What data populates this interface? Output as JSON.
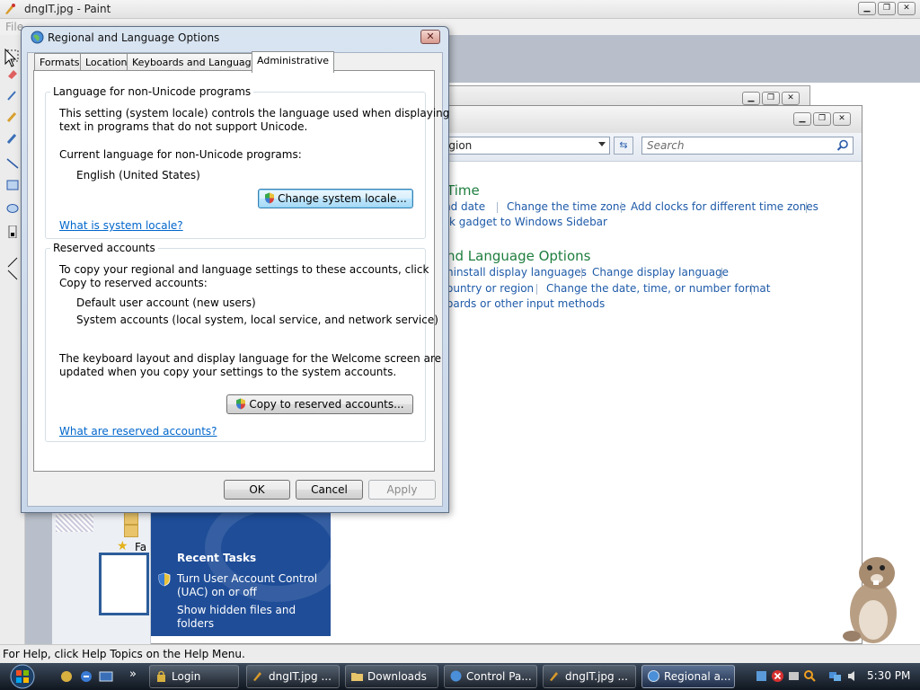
{
  "paint": {
    "title": "dngIT.jpg - Paint",
    "menu_file": "File",
    "status": "For Help, click Help Topics on the Help Menu."
  },
  "control_panel": {
    "address": "egion",
    "search_placeholder": "Search",
    "sections": [
      {
        "heading": "Time",
        "links": [
          "nd date",
          "Change the time zone",
          "Add clocks for different time zones",
          "k gadget to Windows Sidebar"
        ]
      },
      {
        "heading": "nd Language Options",
        "links": [
          "ninstall display languages",
          "Change display language",
          "ountry or region",
          "Change the date, time, or number format",
          "oards or other input methods"
        ]
      }
    ],
    "recent_tasks": {
      "title": "Recent Tasks",
      "items": [
        "Turn User Account Control (UAC) on or off",
        "Show hidden files and folders"
      ]
    },
    "explorer_fav_label": "Fa"
  },
  "dialog": {
    "title": "Regional and Language Options",
    "tabs": [
      "Formats",
      "Location",
      "Keyboards and Languages",
      "Administrative"
    ],
    "active_tab": "Administrative",
    "non_unicode": {
      "group_title": "Language for non-Unicode programs",
      "description_line1": "This setting (system locale) controls the language used when displaying",
      "description_line2": "text in programs that do not support Unicode.",
      "current_label": "Current language for non-Unicode programs:",
      "current_value": "English (United States)",
      "change_button": "Change system locale...",
      "help_link": "What is system locale?"
    },
    "reserved": {
      "group_title": "Reserved accounts",
      "description_line1": "To copy your regional and language settings to these accounts, click",
      "description_line2": "Copy to reserved accounts:",
      "account1": "Default user account (new users)",
      "account2": "System accounts (local system, local service, and network service)",
      "note_line1": "The keyboard layout and display language for the Welcome screen are",
      "note_line2": "updated when you copy your settings to the system accounts.",
      "copy_button": "Copy to reserved accounts...",
      "help_link": "What are reserved accounts?"
    },
    "buttons": {
      "ok": "OK",
      "cancel": "Cancel",
      "apply": "Apply"
    }
  },
  "taskbar": {
    "items": [
      {
        "label": "Login"
      },
      {
        "label": "dngIT.jpg ..."
      },
      {
        "label": "Downloads"
      },
      {
        "label": "Control Pa..."
      },
      {
        "label": "dngIT.jpg ..."
      },
      {
        "label": "Regional a..."
      }
    ],
    "active_item": "Regional a...",
    "quick_launch_more": "»",
    "clock": "5:30 PM"
  },
  "colors": {
    "link": "#0066cc",
    "cp_heading": "#1e7e3e",
    "cp_link": "#1e5aa8",
    "sidebar": "#1f4d98",
    "taskbar": "#10161f"
  }
}
